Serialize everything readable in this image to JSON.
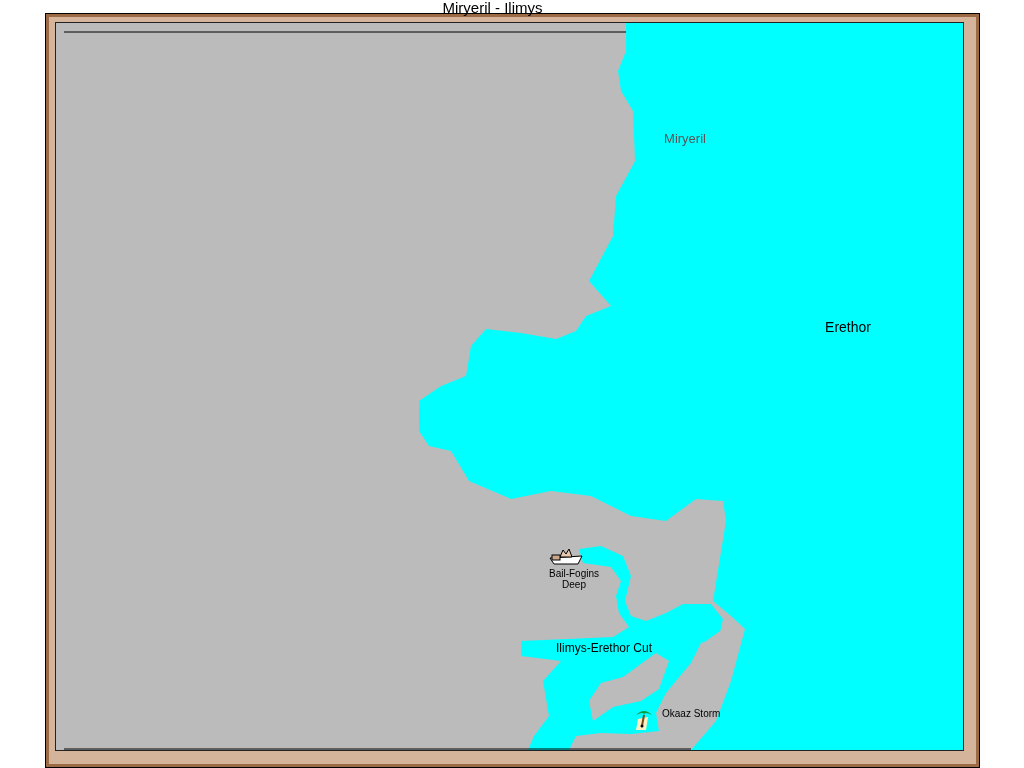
{
  "title": "Miryeril - Ilimys",
  "map": {
    "labels": [
      {
        "text": "Miryeril",
        "kind": "region"
      },
      {
        "text": "Erethor",
        "kind": "sea"
      },
      {
        "text": "Bail-Fogins Deep",
        "kind": "ship"
      },
      {
        "text": "Ilimys-Erethor Cut",
        "kind": "strait"
      },
      {
        "text": "Okaaz Storm",
        "kind": "island"
      }
    ]
  }
}
